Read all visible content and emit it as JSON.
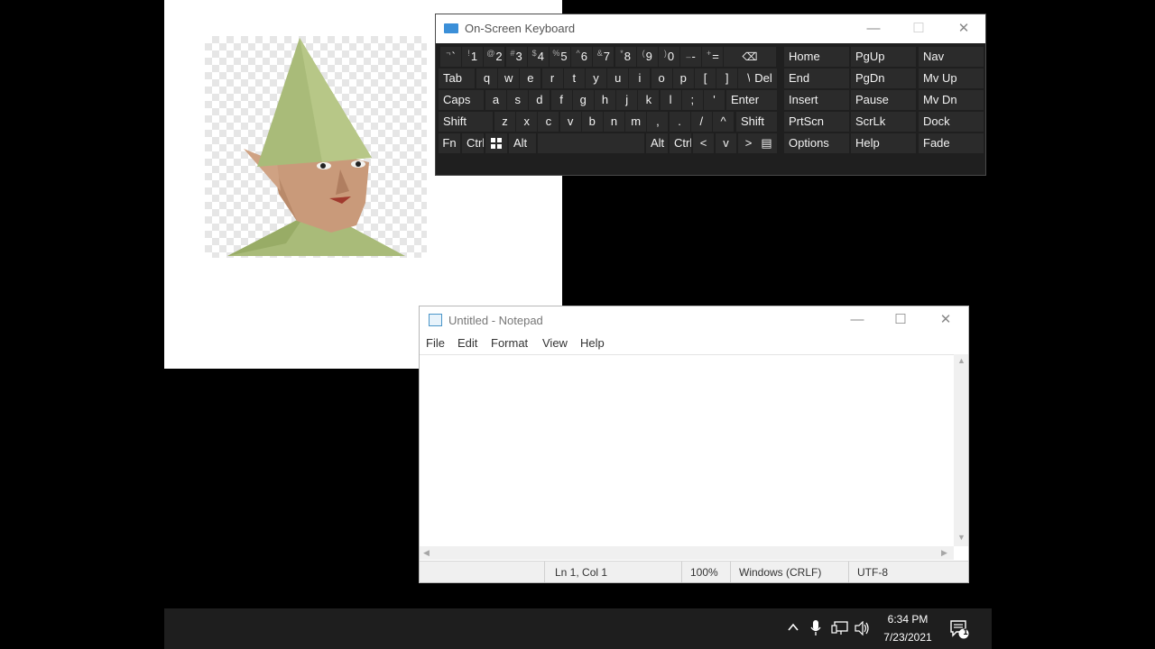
{
  "osk": {
    "title": "On-Screen Keyboard",
    "controls": {
      "minimize": "—",
      "maximize": "☐",
      "close": "✕"
    },
    "row1": [
      {
        "s": "¬",
        "m": "`"
      },
      {
        "s": "!",
        "m": "1"
      },
      {
        "s": "@",
        "m": "2"
      },
      {
        "s": "#",
        "m": "3"
      },
      {
        "s": "$",
        "m": "4"
      },
      {
        "s": "%",
        "m": "5"
      },
      {
        "s": "^",
        "m": "6"
      },
      {
        "s": "&",
        "m": "7"
      },
      {
        "s": "*",
        "m": "8"
      },
      {
        "s": "(",
        "m": "9"
      },
      {
        "s": ")",
        "m": "0"
      },
      {
        "s": "_",
        "m": "-"
      },
      {
        "s": "+",
        "m": "="
      }
    ],
    "backspace_icon": "backspace-icon",
    "row2": [
      "Tab",
      "q",
      "w",
      "e",
      "r",
      "t",
      "y",
      "u",
      "i",
      "o",
      "p",
      "[",
      "]",
      "\\",
      "Del"
    ],
    "row3": [
      "Caps",
      "a",
      "s",
      "d",
      "f",
      "g",
      "h",
      "j",
      "k",
      "l",
      ";",
      "'",
      "Enter"
    ],
    "row4": [
      "Shift",
      "z",
      "x",
      "c",
      "v",
      "b",
      "n",
      "m",
      ",",
      ".",
      "/",
      "^",
      "Shift"
    ],
    "row5": [
      "Fn",
      "Ctrl",
      "Alt",
      "Alt",
      "Ctrl",
      "<",
      "v",
      ">"
    ],
    "nav_keys": [
      [
        "Home",
        "PgUp",
        "Nav"
      ],
      [
        "End",
        "PgDn",
        "Mv Up"
      ],
      [
        "Insert",
        "Pause",
        "Mv Dn"
      ],
      [
        "PrtScn",
        "ScrLk",
        "Dock"
      ],
      [
        "Options",
        "Help",
        "Fade"
      ]
    ]
  },
  "notepad": {
    "title": "Untitled - Notepad",
    "controls": {
      "minimize": "—",
      "maximize": "☐",
      "close": "✕"
    },
    "menu": [
      "File",
      "Edit",
      "Format",
      "View",
      "Help"
    ],
    "content": "",
    "status": {
      "position": "Ln 1, Col 1",
      "zoom": "100%",
      "line_endings": "Windows (CRLF)",
      "encoding": "UTF-8"
    }
  },
  "taskbar": {
    "time": "6:34 PM",
    "date": "7/23/2021",
    "notification_count": "1",
    "tray_icons": [
      "chevron-up-icon",
      "microphone-icon",
      "network-icon",
      "volume-icon",
      "notification-icon"
    ]
  },
  "colors": {
    "osk_bg": "#1f1f1f",
    "osk_key": "#2b2b2b",
    "taskbar": "#1e1e1e",
    "accent": "#3b8fd8"
  }
}
